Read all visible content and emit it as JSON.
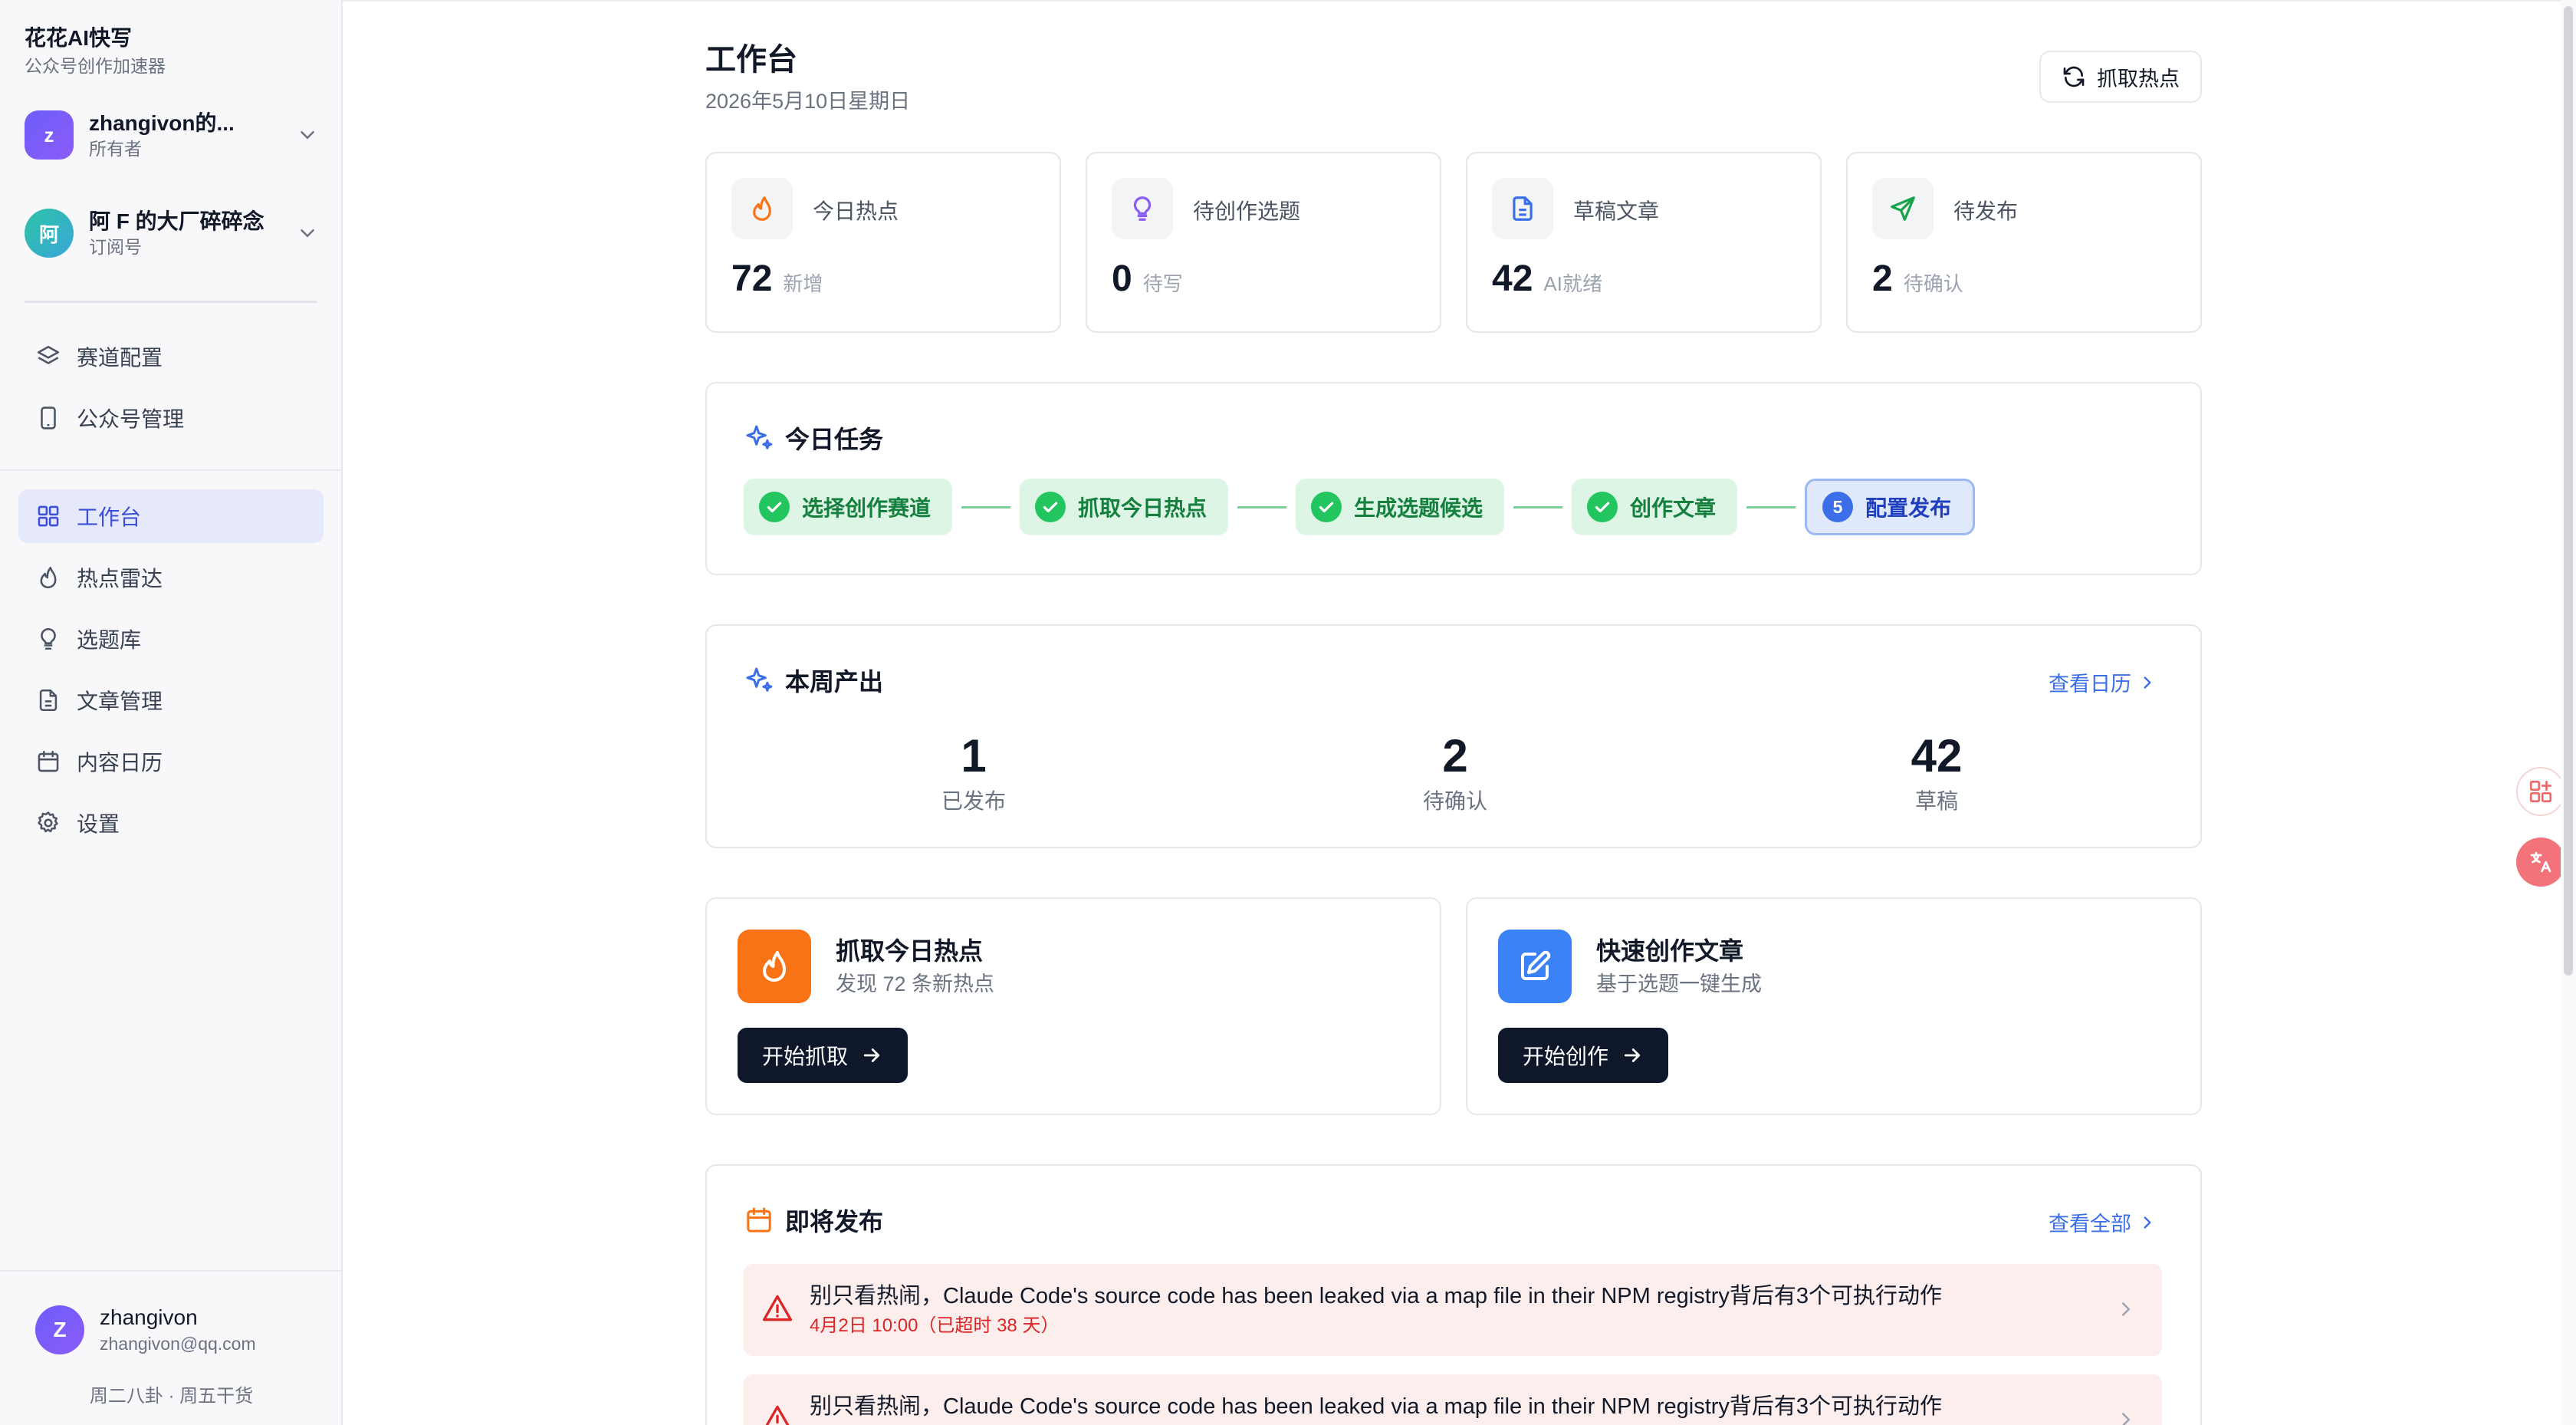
{
  "brand": {
    "title": "花花AI快写",
    "subtitle": "公众号创作加速器"
  },
  "workspace": {
    "initial": "z",
    "name": "zhangivon的...",
    "role": "所有者",
    "color": "#6d5dfc"
  },
  "account": {
    "initial": "阿",
    "name": "阿 F 的大厂碎碎念",
    "role": "订阅号",
    "color": "#22b5a6"
  },
  "config_nav": [
    {
      "label": "赛道配置",
      "icon": "layers-icon"
    },
    {
      "label": "公众号管理",
      "icon": "phone-icon"
    }
  ],
  "main_nav": [
    {
      "label": "工作台",
      "icon": "grid-icon",
      "active": true
    },
    {
      "label": "热点雷达",
      "icon": "flame-icon",
      "active": false
    },
    {
      "label": "选题库",
      "icon": "lightbulb-icon",
      "active": false
    },
    {
      "label": "文章管理",
      "icon": "document-icon",
      "active": false
    },
    {
      "label": "内容日历",
      "icon": "calendar-icon",
      "active": false
    },
    {
      "label": "设置",
      "icon": "gear-icon",
      "active": false
    }
  ],
  "user": {
    "initial": "Z",
    "name": "zhangivon",
    "email": "zhangivon@qq.com"
  },
  "footer_tag": "周二八卦 · 周五干货",
  "header": {
    "title": "工作台",
    "date": "2026年5月10日星期日",
    "fetch_button": "抓取热点"
  },
  "stats": [
    {
      "label": "今日热点",
      "value": "72",
      "unit": "新增",
      "icon": "flame-icon",
      "color": "#f97316"
    },
    {
      "label": "待创作选题",
      "value": "0",
      "unit": "待写",
      "icon": "lightbulb-icon",
      "color": "#8b5cf6"
    },
    {
      "label": "草稿文章",
      "value": "42",
      "unit": "AI就绪",
      "icon": "document-icon",
      "color": "#3b6ee8"
    },
    {
      "label": "待发布",
      "value": "2",
      "unit": "待确认",
      "icon": "send-icon",
      "color": "#16a34a"
    }
  ],
  "tasks": {
    "title": "今日任务",
    "steps": [
      {
        "label": "选择创作赛道",
        "done": true
      },
      {
        "label": "抓取今日热点",
        "done": true
      },
      {
        "label": "生成选题候选",
        "done": true
      },
      {
        "label": "创作文章",
        "done": true
      },
      {
        "label": "配置发布",
        "done": false,
        "number": "5"
      }
    ]
  },
  "weekly": {
    "title": "本周产出",
    "link": "查看日历",
    "items": [
      {
        "value": "1",
        "label": "已发布"
      },
      {
        "value": "2",
        "label": "待确认"
      },
      {
        "value": "42",
        "label": "草稿"
      }
    ]
  },
  "quick_actions": [
    {
      "title": "抓取今日热点",
      "desc": "发现 72 条新热点",
      "button": "开始抓取",
      "color": "#f97316",
      "icon": "flame-icon"
    },
    {
      "title": "快速创作文章",
      "desc": "基于选题一键生成",
      "button": "开始创作",
      "color": "#3b82f6",
      "icon": "edit-icon"
    }
  ],
  "upcoming": {
    "title": "即将发布",
    "link": "查看全部",
    "items": [
      {
        "title": "别只看热闹，Claude Code's source code has been leaked via a map file in their NPM registry背后有3个可执行动作",
        "meta": "4月2日 10:00（已超时 38 天）"
      },
      {
        "title": "别只看热闹，Claude Code's source code has been leaked via a map file in their NPM registry背后有3个可执行动作",
        "meta": ""
      }
    ]
  }
}
